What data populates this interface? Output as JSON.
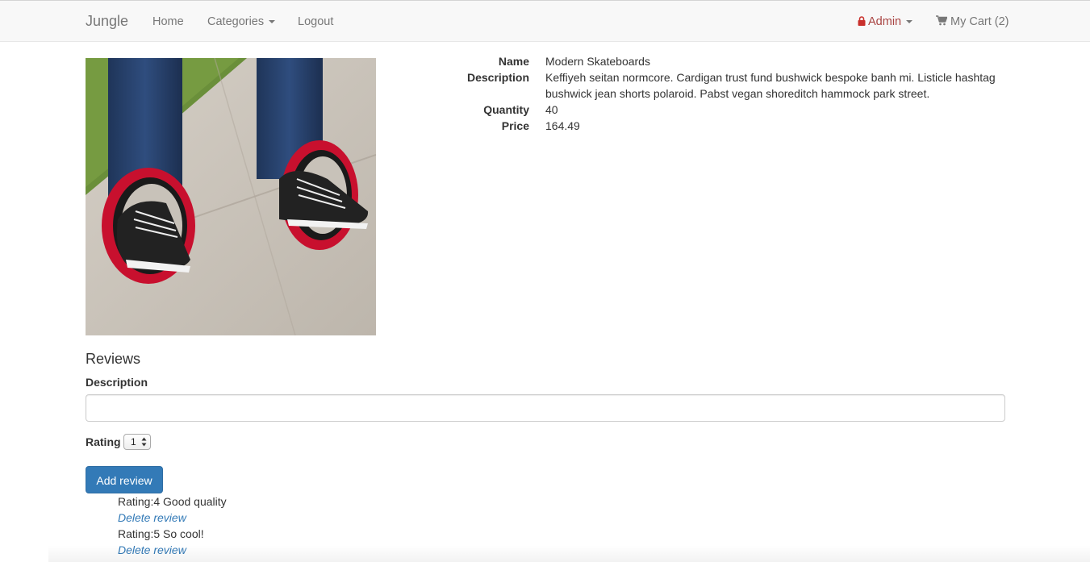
{
  "navbar": {
    "brand": "Jungle",
    "home": "Home",
    "categories": "Categories",
    "logout": "Logout",
    "admin": "Admin",
    "cart": "My Cart (2)",
    "colors": {
      "background": "#f8f8f8",
      "link": "#777777",
      "admin": "#a94442"
    },
    "icons": {
      "admin": "lock-icon",
      "cart": "shopping-cart-icon",
      "dropdown": "caret-down-icon"
    }
  },
  "product": {
    "image_subject": "person riding red circular drift skates on sidewalk",
    "fields": [
      {
        "label": "Name",
        "value": "Modern Skateboards"
      },
      {
        "label": "Description",
        "value": "Keffiyeh seitan normcore. Cardigan trust fund bushwick bespoke banh mi. Listicle hashtag bushwick jean shorts polaroid. Pabst vegan shoreditch hammock park street."
      },
      {
        "label": "Quantity",
        "value": "40"
      },
      {
        "label": "Price",
        "value": "164.49"
      }
    ]
  },
  "reviews": {
    "title": "Reviews",
    "description_label": "Description",
    "description_value": "",
    "description_placeholder": "",
    "rating_label": "Rating",
    "rating_selected": "1",
    "add_button": "Add review",
    "items": [
      {
        "text": "Rating:4 Good quality",
        "delete": "Delete review"
      },
      {
        "text": "Rating:5 So cool!",
        "delete": "Delete review"
      }
    ],
    "colors": {
      "button": "#337ab7",
      "link": "#337ab7"
    }
  }
}
